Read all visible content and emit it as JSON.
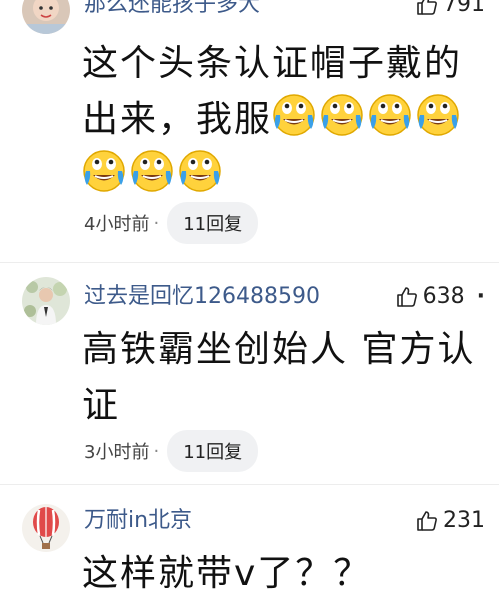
{
  "comments": [
    {
      "username": "那么还能孩子多大",
      "likes": "791",
      "text": "这个头条认证帽子戴的出来，我服",
      "time": "4小时前",
      "replies": "11回复"
    },
    {
      "username": "过去是回忆126488590",
      "likes": "638",
      "text": "高铁霸坐创始人 官方认证",
      "time": "3小时前",
      "replies": "11回复"
    },
    {
      "username": "万耐in北京",
      "likes": "231",
      "text": "这样就带v了？？"
    }
  ],
  "dot": "·",
  "more": "·",
  "icons": {
    "like": "thumbs-up-icon",
    "emoji": "crying-laughing-emoji-icon"
  },
  "colors": {
    "username": "#3d5a8a",
    "reply_pill_bg": "#f0f1f3",
    "emoji_face": "#ffd23c",
    "emoji_tears": "#3aa0e8"
  }
}
